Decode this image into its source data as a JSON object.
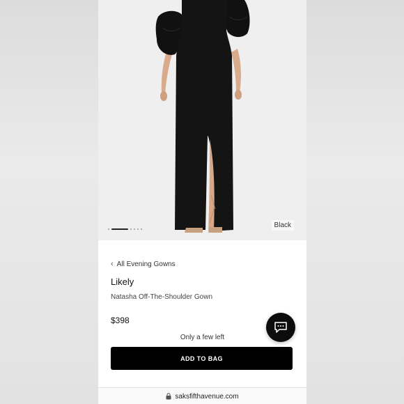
{
  "product": {
    "color_label": "Black",
    "back_link": "All Evening Gowns",
    "brand": "Likely",
    "name": "Natasha Off-The-Shoulder Gown",
    "price": "$398",
    "stock_note": "Only a few left",
    "add_to_bag_label": "ADD TO BAG"
  },
  "carousel": {
    "total_images": 6,
    "active_index": 1
  },
  "browser": {
    "url": "saksfifthavenue.com"
  },
  "icons": {
    "back": "chevron-left-icon",
    "chat": "chat-bubble-icon",
    "lock": "lock-icon"
  },
  "colors": {
    "accent": "#000000",
    "page_bg": "#ffffff",
    "hero_bg": "#efefef"
  }
}
